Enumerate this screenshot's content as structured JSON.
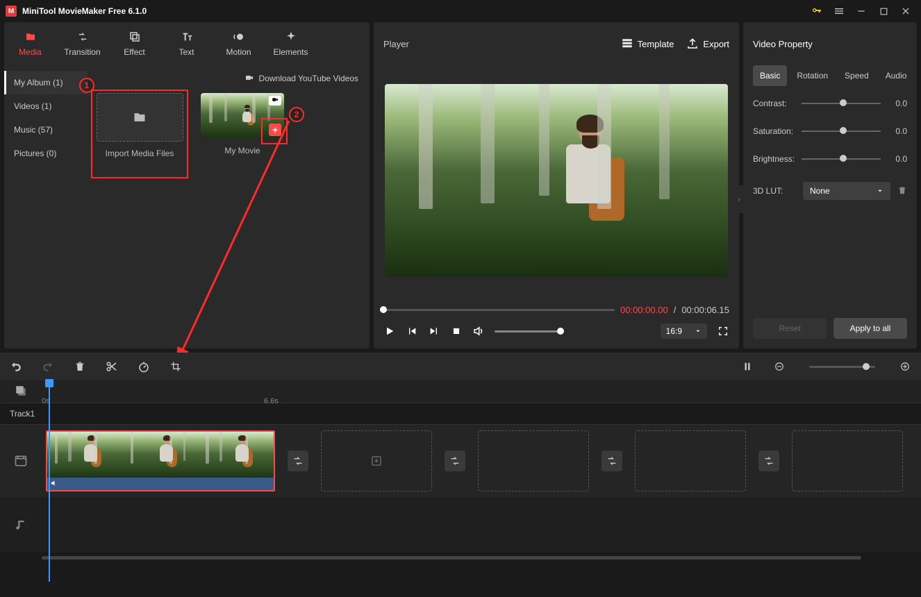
{
  "app": {
    "title": "MiniTool MovieMaker Free 6.1.0"
  },
  "tabs": {
    "media": "Media",
    "transition": "Transition",
    "effect": "Effect",
    "text": "Text",
    "motion": "Motion",
    "elements": "Elements"
  },
  "sidebar": {
    "album": "My Album (1)",
    "videos": "Videos (1)",
    "music": "Music (57)",
    "pictures": "Pictures (0)"
  },
  "mediaHeader": {
    "download": "Download YouTube Videos"
  },
  "thumbs": {
    "import": "Import Media Files",
    "mymovie": "My Movie"
  },
  "annotations": {
    "num1": "1",
    "num2": "2"
  },
  "player": {
    "title": "Player",
    "template": "Template",
    "export": "Export",
    "current": "00:00:00.00",
    "sep": " / ",
    "total": "00:00:06.15",
    "ratio": "16:9"
  },
  "props": {
    "title": "Video Property",
    "tabs": {
      "basic": "Basic",
      "rotation": "Rotation",
      "speed": "Speed",
      "audio": "Audio"
    },
    "contrast": {
      "label": "Contrast:",
      "value": "0.0"
    },
    "saturation": {
      "label": "Saturation:",
      "value": "0.0"
    },
    "brightness": {
      "label": "Brightness:",
      "value": "0.0"
    },
    "lut": {
      "label": "3D LUT:",
      "value": "None"
    },
    "reset": "Reset",
    "apply": "Apply to all"
  },
  "timeline": {
    "t0": "0s",
    "t1": "6.6s",
    "track1": "Track1"
  }
}
